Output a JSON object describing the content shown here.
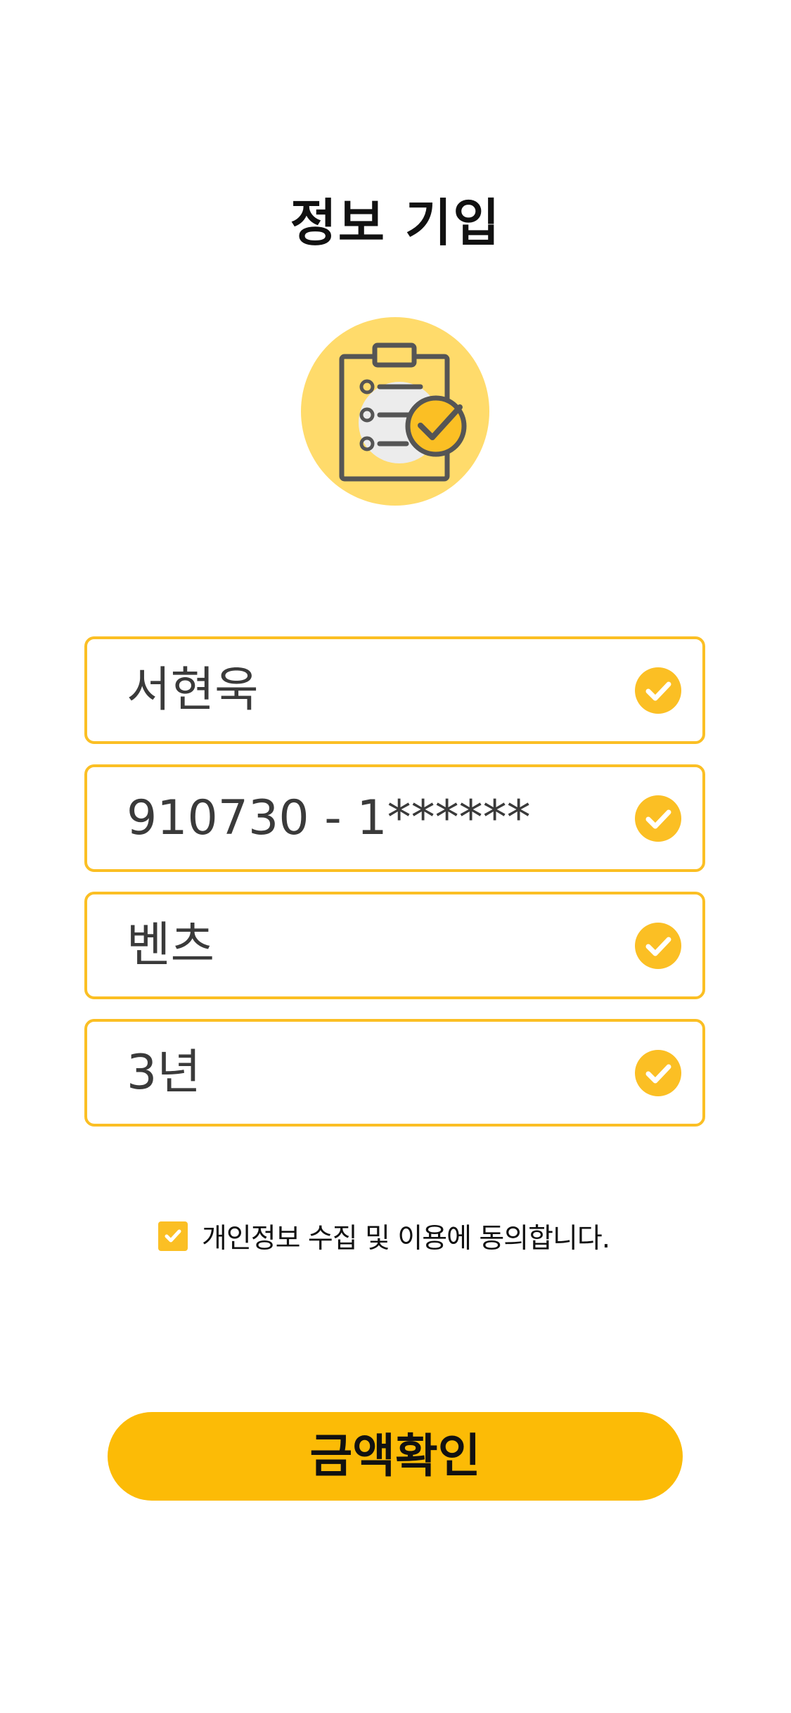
{
  "header": {
    "title": "정보 기입"
  },
  "hero": {
    "icon": "clipboard-check-icon",
    "circle_color": "#ffdb6b"
  },
  "form": {
    "fields": [
      {
        "name": "name",
        "value": "서현욱",
        "verified": true
      },
      {
        "name": "resident-number",
        "value": "910730 - 1******",
        "verified": true
      },
      {
        "name": "car-brand",
        "value": "벤츠",
        "verified": true
      },
      {
        "name": "period",
        "value": "3년",
        "verified": true
      }
    ],
    "accent_color": "#fbbf24"
  },
  "consent": {
    "checked": true,
    "label": "개인정보 수집 및 이용에 동의합니다."
  },
  "actions": {
    "confirm_label": "금액확인",
    "confirm_color": "#fcbb06"
  }
}
